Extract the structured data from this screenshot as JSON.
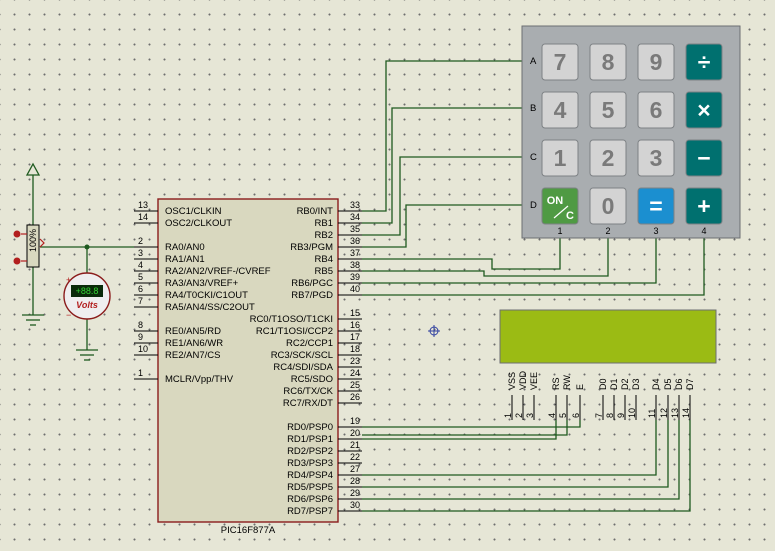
{
  "mcu": {
    "part": "PIC16F877A",
    "left_pins": [
      {
        "num": "13",
        "name": "OSC1/CLKIN"
      },
      {
        "num": "14",
        "name": "OSC2/CLKOUT"
      },
      {
        "num": "2",
        "name": "RA0/AN0"
      },
      {
        "num": "3",
        "name": "RA1/AN1"
      },
      {
        "num": "4",
        "name": "RA2/AN2/VREF-/CVREF"
      },
      {
        "num": "5",
        "name": "RA3/AN3/VREF+"
      },
      {
        "num": "6",
        "name": "RA4/T0CKI/C1OUT"
      },
      {
        "num": "7",
        "name": "RA5/AN4/SS/C2OUT"
      },
      {
        "num": "8",
        "name": "RE0/AN5/RD"
      },
      {
        "num": "9",
        "name": "RE1/AN6/WR"
      },
      {
        "num": "10",
        "name": "RE2/AN7/CS"
      },
      {
        "num": "1",
        "name": "MCLR/Vpp/THV"
      }
    ],
    "right_pins": [
      {
        "num": "33",
        "name": "RB0/INT"
      },
      {
        "num": "34",
        "name": "RB1"
      },
      {
        "num": "35",
        "name": "RB2"
      },
      {
        "num": "36",
        "name": "RB3/PGM"
      },
      {
        "num": "37",
        "name": "RB4"
      },
      {
        "num": "38",
        "name": "RB5"
      },
      {
        "num": "39",
        "name": "RB6/PGC"
      },
      {
        "num": "40",
        "name": "RB7/PGD"
      },
      {
        "num": "15",
        "name": "RC0/T1OSO/T1CKI"
      },
      {
        "num": "16",
        "name": "RC1/T1OSI/CCP2"
      },
      {
        "num": "17",
        "name": "RC2/CCP1"
      },
      {
        "num": "18",
        "name": "RC3/SCK/SCL"
      },
      {
        "num": "23",
        "name": "RC4/SDI/SDA"
      },
      {
        "num": "24",
        "name": "RC5/SDO"
      },
      {
        "num": "25",
        "name": "RC6/TX/CK"
      },
      {
        "num": "26",
        "name": "RC7/RX/DT"
      },
      {
        "num": "19",
        "name": "RD0/PSP0"
      },
      {
        "num": "20",
        "name": "RD1/PSP1"
      },
      {
        "num": "21",
        "name": "RD2/PSP2"
      },
      {
        "num": "22",
        "name": "RD3/PSP3"
      },
      {
        "num": "27",
        "name": "RD4/PSP4"
      },
      {
        "num": "28",
        "name": "RD5/PSP5"
      },
      {
        "num": "29",
        "name": "RD6/PSP6"
      },
      {
        "num": "30",
        "name": "RD7/PSP7"
      }
    ]
  },
  "keypad": {
    "row_labels": [
      "A",
      "B",
      "C",
      "D"
    ],
    "col_labels": [
      "1",
      "2",
      "3",
      "4"
    ],
    "keys": [
      [
        "7",
        "8",
        "9",
        "÷"
      ],
      [
        "4",
        "5",
        "6",
        "×"
      ],
      [
        "1",
        "2",
        "3",
        "−"
      ],
      [
        "ON/C",
        "0",
        "=",
        "+"
      ]
    ]
  },
  "lcd": {
    "pins": [
      {
        "name": "VSS",
        "num": "1"
      },
      {
        "name": "VDD",
        "num": "2"
      },
      {
        "name": "VEE",
        "num": "3"
      },
      {
        "name": "RS",
        "num": "4"
      },
      {
        "name": "RW",
        "num": "5"
      },
      {
        "name": "E",
        "num": "6"
      },
      {
        "name": "D0",
        "num": "7"
      },
      {
        "name": "D1",
        "num": "8"
      },
      {
        "name": "D2",
        "num": "9"
      },
      {
        "name": "D3",
        "num": "10"
      },
      {
        "name": "D4",
        "num": "11"
      },
      {
        "name": "D5",
        "num": "12"
      },
      {
        "name": "D6",
        "num": "13"
      },
      {
        "name": "D7",
        "num": "14"
      }
    ]
  },
  "pot": {
    "label": "100%"
  },
  "voltmeter": {
    "unit": "Volts",
    "display": "+88.8"
  },
  "colors": {
    "wire": "#1f5a1f",
    "chip_fill": "#d9d8bf",
    "chip_border": "#8b1c1c",
    "lcd_screen": "#9bbb14",
    "keypad_body": "#a9adb0",
    "teal_key": "#00706f",
    "blue_key": "#1b8fd0",
    "green_key": "#4f9a43"
  }
}
